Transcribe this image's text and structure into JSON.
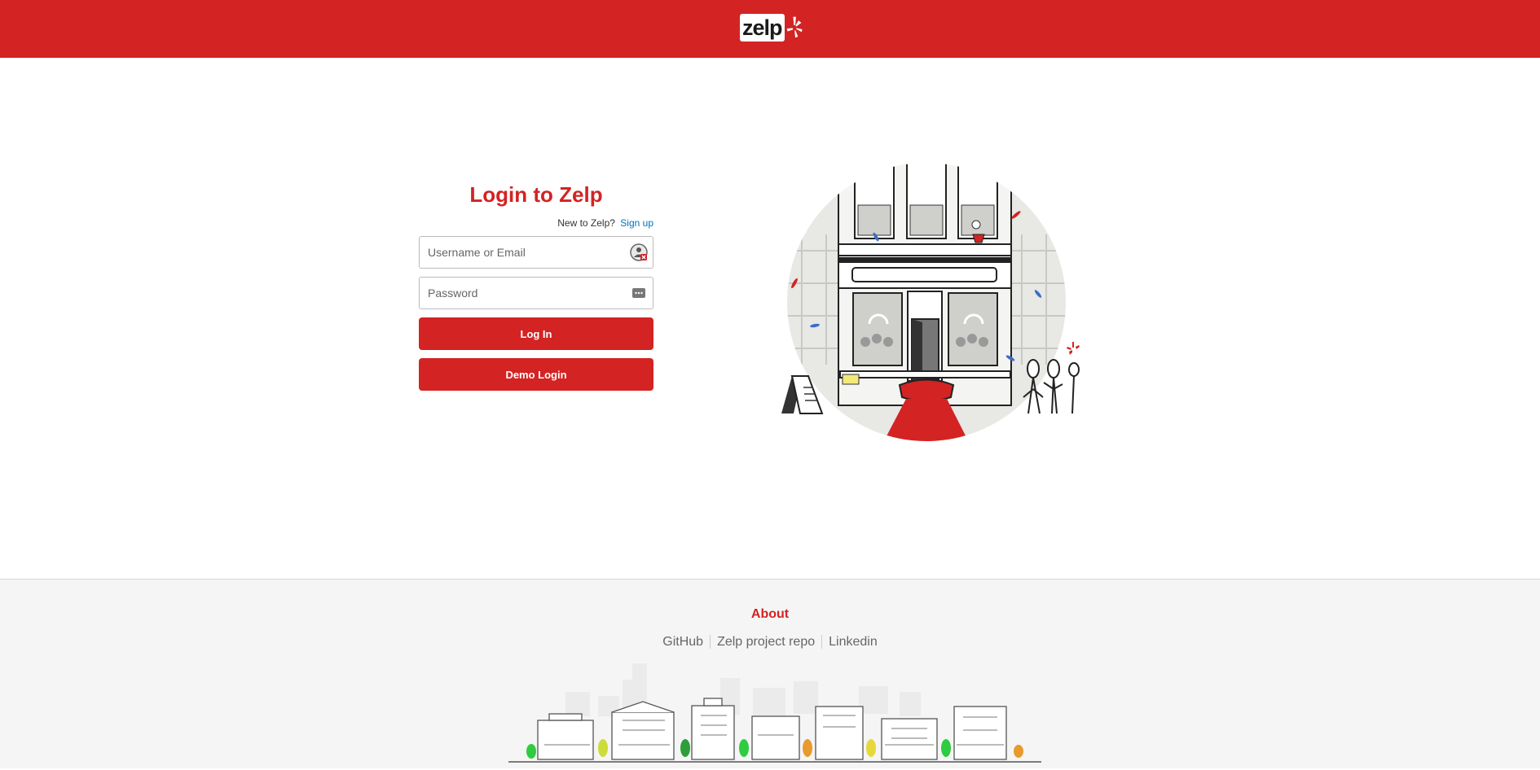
{
  "header": {
    "logo_text": "zelp",
    "brand_color": "#d32323"
  },
  "login": {
    "title": "Login to Zelp",
    "new_prompt": "New to Zelp?",
    "signup_label": "Sign up",
    "username_placeholder": "Username or Email",
    "password_placeholder": "Password",
    "username_icon": "account-helper-icon",
    "password_icon": "password-dots-icon",
    "login_button": "Log In",
    "demo_button": "Demo Login"
  },
  "footer": {
    "title": "About",
    "links": [
      "GitHub",
      "Zelp project repo",
      "Linkedin"
    ]
  }
}
